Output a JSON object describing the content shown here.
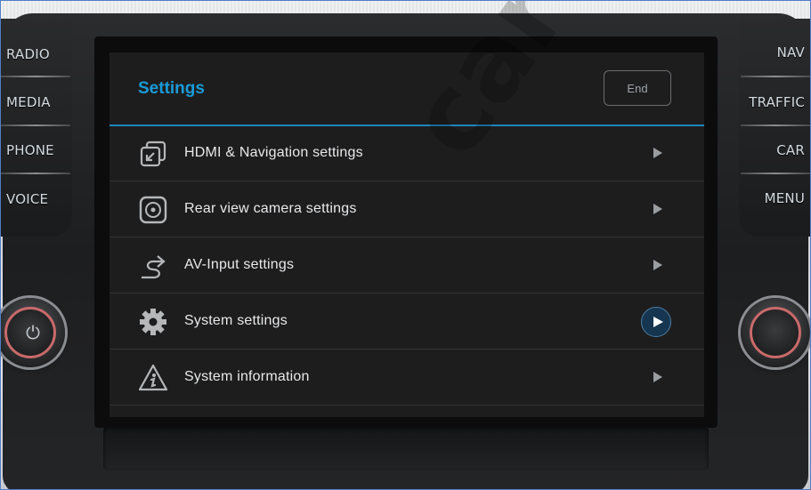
{
  "left_buttons": [
    {
      "label": "RADIO"
    },
    {
      "label": "MEDIA"
    },
    {
      "label": "PHONE"
    },
    {
      "label": "VOICE"
    }
  ],
  "right_buttons": [
    {
      "label": "NAV"
    },
    {
      "label": "TRAFFIC"
    },
    {
      "label": "CAR"
    },
    {
      "label": "MENU"
    }
  ],
  "screen": {
    "title": "Settings",
    "end_label": "End",
    "items": [
      {
        "label": "HDMI & Navigation settings",
        "icon": "hdmi-navigation-icon"
      },
      {
        "label": "Rear view camera settings",
        "icon": "camera-icon"
      },
      {
        "label": "AV-Input settings",
        "icon": "av-input-icon"
      },
      {
        "label": "System settings",
        "icon": "gear-icon",
        "selected": true
      },
      {
        "label": "System information",
        "icon": "info-warning-icon"
      }
    ]
  },
  "knobs": {
    "left_icon": "power-icon",
    "left_glyph": "⏻"
  },
  "colors": {
    "accent": "#1a9bd8",
    "divider": "#1f84bf",
    "button_text": "#d2dbe1",
    "knob_ring": "#c96a6a"
  },
  "watermark": "car-sol"
}
